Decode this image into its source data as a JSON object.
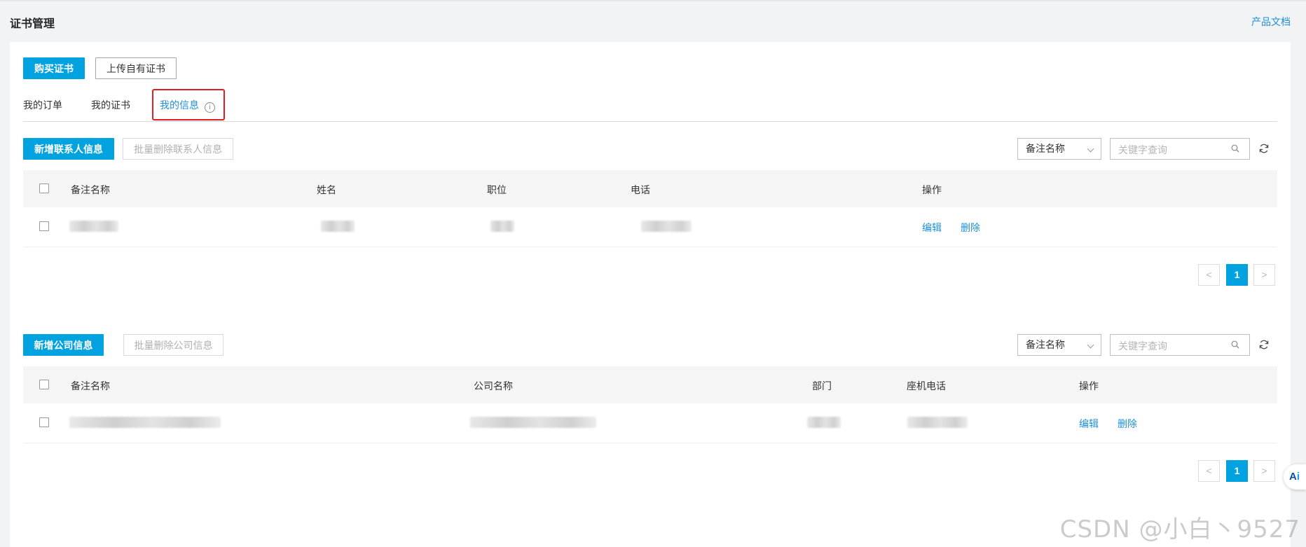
{
  "header": {
    "title": "证书管理",
    "doc_link": "产品文档"
  },
  "toolbar": {
    "buy_label": "购买证书",
    "upload_label": "上传自有证书"
  },
  "tabs": [
    {
      "label": "我的订单"
    },
    {
      "label": "我的证书"
    },
    {
      "label": "我的信息",
      "active": true,
      "info_icon": "info-circle-icon"
    }
  ],
  "contacts": {
    "add_label": "新增联系人信息",
    "batch_delete_label": "批量删除联系人信息",
    "filter_selected": "备注名称",
    "search_placeholder": "关键字查询",
    "columns": [
      "备注名称",
      "姓名",
      "职位",
      "电话",
      "操作"
    ],
    "rows": [
      {
        "actions": [
          "编辑",
          "删除"
        ]
      }
    ],
    "pagination": {
      "current": "1",
      "prev": "<",
      "next": ">"
    }
  },
  "companies": {
    "add_label": "新增公司信息",
    "batch_delete_label": "批量删除公司信息",
    "filter_selected": "备注名称",
    "search_placeholder": "关键字查询",
    "columns": [
      "备注名称",
      "公司名称",
      "部门",
      "座机电话",
      "操作"
    ],
    "rows": [
      {
        "actions": [
          "编辑",
          "删除"
        ]
      }
    ],
    "pagination": {
      "current": "1",
      "prev": "<",
      "next": ">"
    }
  },
  "float_widget": {
    "label_a": "A",
    "label_i": "i"
  },
  "watermark": "CSDN @小白丶9527",
  "colors": {
    "primary": "#00a2e0",
    "link": "#1f8fd6",
    "highlight": "#e02020"
  }
}
